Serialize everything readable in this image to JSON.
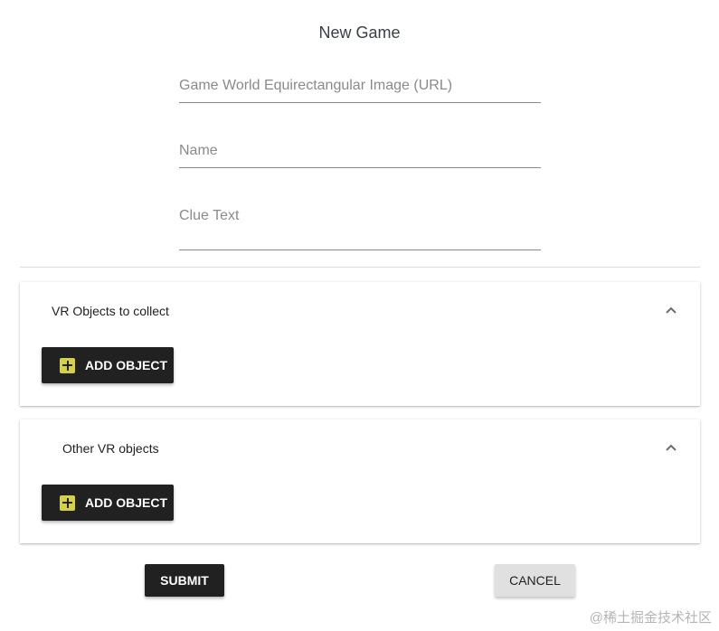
{
  "form": {
    "title": "New Game",
    "fields": {
      "image_url": {
        "placeholder": "Game World Equirectangular Image (URL)",
        "value": ""
      },
      "name": {
        "placeholder": "Name",
        "value": ""
      },
      "clue_text": {
        "placeholder": "Clue Text",
        "value": ""
      }
    }
  },
  "panels": [
    {
      "title": "VR Objects to collect",
      "add_label": "ADD OBJECT",
      "expanded": true
    },
    {
      "title": "Other VR objects",
      "add_label": "ADD OBJECT",
      "expanded": true
    }
  ],
  "actions": {
    "submit_label": "SUBMIT",
    "cancel_label": "CANCEL"
  },
  "watermark": "@稀土掘金技术社区",
  "colors": {
    "primary_button": "#212121",
    "plus_accent": "#d4d148",
    "secondary_button": "#e0e0e0"
  },
  "icons": {
    "panel_toggle": "chevron-up-icon",
    "add": "plus-icon"
  }
}
